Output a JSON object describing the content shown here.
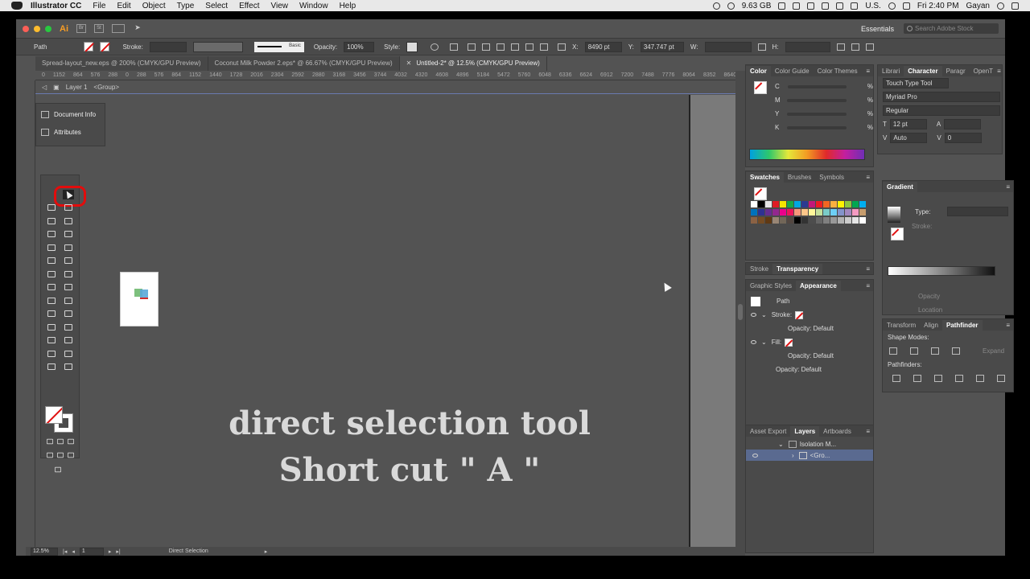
{
  "menubar": {
    "app_name": "Illustrator CC",
    "menus": [
      "File",
      "Edit",
      "Object",
      "Type",
      "Select",
      "Effect",
      "View",
      "Window",
      "Help"
    ],
    "memory": "9.63 GB",
    "locale": "U.S.",
    "clock": "Fri 2:40 PM",
    "user": "Gayan"
  },
  "titlebar": {
    "logo": "Ai",
    "bridge": "Br",
    "stock_btn": "St",
    "workspace": "Essentials",
    "search_placeholder": "Search Adobe Stock"
  },
  "control_bar": {
    "selection_label": "Path",
    "stroke_label": "Stroke:",
    "brush_label": "Basic",
    "opacity_label": "Opacity:",
    "opacity_value": "100%",
    "style_label": "Style:",
    "x_label": "X:",
    "x_value": "8490 pt",
    "y_label": "Y:",
    "y_value": "347.747 pt",
    "w_label": "W:",
    "h_label": "H:"
  },
  "doc_tabs": [
    {
      "label": "Spread-layout_new.eps @ 200% (CMYK/GPU Preview)",
      "active": false
    },
    {
      "label": "Coconut Milk Powder 2.eps* @ 66.67% (CMYK/GPU Preview)",
      "active": false
    },
    {
      "label": "Untitled-2* @ 12.5% (CMYK/GPU Preview)",
      "active": true
    }
  ],
  "ruler_ticks": [
    "0",
    "1152",
    "864",
    "576",
    "288",
    "0",
    "288",
    "576",
    "864",
    "1152",
    "1440",
    "1728",
    "2016",
    "2304",
    "2592",
    "2880",
    "3168",
    "3456",
    "3744",
    "4032",
    "4320",
    "4608",
    "4896",
    "5184",
    "5472",
    "5760",
    "6048",
    "6336",
    "6624",
    "6912",
    "7200",
    "7488",
    "7776",
    "8064",
    "8352",
    "8640",
    "8928"
  ],
  "layer_bar": {
    "layer": "Layer 1",
    "group": "<Group>"
  },
  "float_panel": {
    "items": [
      "Document Info",
      "Attributes"
    ]
  },
  "caption": {
    "line1": "direct selection tool",
    "line2": "Short cut \" A \""
  },
  "status": {
    "zoom": "12.5%",
    "artboard": "1",
    "tool": "Direct Selection"
  },
  "color_panel": {
    "tabs": [
      "Color",
      "Color Guide",
      "Color Themes"
    ],
    "channels": [
      "C",
      "M",
      "Y",
      "K"
    ],
    "unit": "%"
  },
  "swatches_panel": {
    "tabs": [
      "Swatches",
      "Brushes",
      "Symbols"
    ]
  },
  "stroke_transparency": {
    "tabs": [
      "Stroke",
      "Transparency"
    ]
  },
  "appearance_panel": {
    "tabs": [
      "Graphic Styles",
      "Appearance"
    ],
    "path_label": "Path",
    "stroke_label": "Stroke:",
    "stroke_opacity": "Opacity: Default",
    "fill_label": "Fill:",
    "fill_opacity": "Opacity: Default",
    "opacity": "Opacity: Default"
  },
  "layers_panel": {
    "tabs": [
      "Asset Export",
      "Layers",
      "Artboards"
    ],
    "rows": [
      "Isolation M...",
      "<Gro..."
    ]
  },
  "character_panel": {
    "tabs": [
      "Librari",
      "Character",
      "Paragr",
      "OpenT"
    ],
    "touch_type": "Touch Type Tool",
    "font": "Myriad Pro",
    "style": "Regular",
    "size": "12 pt",
    "leading": "Auto",
    "tracking": "0"
  },
  "gradient_panel": {
    "title": "Gradient",
    "type_label": "Type:",
    "stroke_label": "Stroke:",
    "opacity_label": "Opacity",
    "location_label": "Location"
  },
  "pathfinder_panel": {
    "tabs": [
      "Transform",
      "Align",
      "Pathfinder"
    ],
    "shape_modes": "Shape Modes:",
    "expand": "Expand",
    "pathfinders": "Pathfinders:"
  },
  "colors": {
    "accent_ai": "#f59c25",
    "highlight_ring": "#e30c0c",
    "ui_bg": "#535353"
  }
}
